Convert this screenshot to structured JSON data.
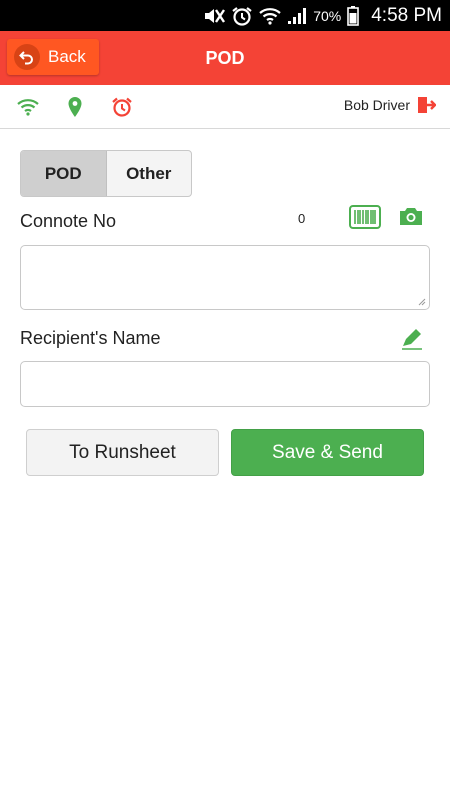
{
  "status_bar": {
    "battery": "70%",
    "time": "4:58 PM",
    "icons": [
      "mute-icon",
      "alarm-icon",
      "wifi-icon",
      "signal-icon",
      "battery-icon"
    ]
  },
  "header": {
    "back_label": "Back",
    "title": "POD",
    "color": "#f44336",
    "back_color": "#ff5722"
  },
  "info_bar": {
    "icons": [
      "wifi-icon",
      "location-icon",
      "alarm-icon"
    ],
    "driver_name": "Bob Driver",
    "logout_icon": "logout-icon"
  },
  "tabs": [
    {
      "label": "POD",
      "active": true
    },
    {
      "label": "Other",
      "active": false
    }
  ],
  "connote": {
    "label": "Connote No",
    "count": "0",
    "value": "",
    "icons": [
      "barcode-icon",
      "camera-icon"
    ]
  },
  "recipient": {
    "label": "Recipient's Name",
    "value": "",
    "icon": "signature-pen-icon"
  },
  "actions": {
    "runsheet_label": "To Runsheet",
    "save_label": "Save & Send",
    "save_color": "#4caf50"
  }
}
